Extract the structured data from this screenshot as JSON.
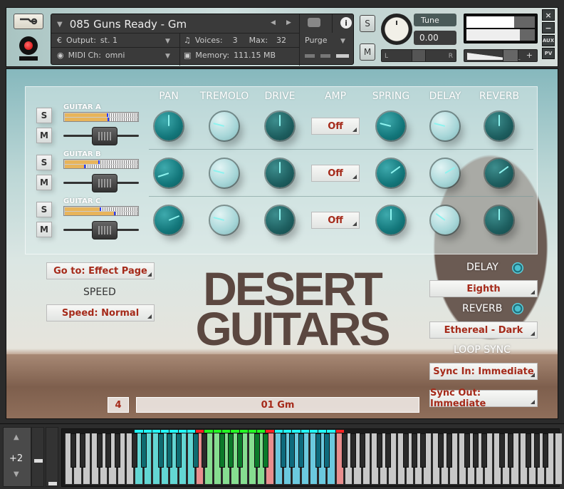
{
  "header": {
    "instrument_name": "085 Guns Ready - Gm",
    "output_label": "Output:",
    "output_value": "st. 1",
    "voices_label": "Voices:",
    "voices_value": "3",
    "max_label": "Max:",
    "max_value": "32",
    "midi_label": "MIDI Ch:",
    "midi_value": "omni",
    "memory_label": "Memory:",
    "memory_value": "111.15 MB",
    "purge_label": "Purge",
    "solo": "S",
    "mute": "M",
    "tune_label": "Tune",
    "tune_value": "0.00",
    "pan_left": "L",
    "pan_right": "R",
    "vol_minus": "−",
    "vol_plus": "+",
    "close": "×",
    "minimize": "−",
    "aux": "AUX",
    "pv": "PV",
    "meter_levels": [
      0.7,
      0.78
    ]
  },
  "fx": {
    "columns": [
      "PAN",
      "TREMOLO",
      "DRIVE",
      "AMP",
      "SPRING",
      "DELAY",
      "REVERB"
    ],
    "tracks": [
      {
        "name": "GUITAR A",
        "solo": "S",
        "mute": "M",
        "meter": [
          0.6,
          0.61
        ],
        "fader": 0.55,
        "amp": "Off",
        "knobs": {
          "pan": 0.5,
          "tremolo": 0.22,
          "drive": 0.5,
          "spring": 0.22,
          "delay": 0.22,
          "reverb": 0.5
        }
      },
      {
        "name": "GUITAR B",
        "solo": "S",
        "mute": "M",
        "meter": [
          0.48,
          0.28
        ],
        "fader": 0.55,
        "amp": "Off",
        "knobs": {
          "pan": 0.1,
          "tremolo": 0.22,
          "drive": 0.5,
          "spring": 0.7,
          "delay": 0.72,
          "reverb": 0.7
        }
      },
      {
        "name": "GUITAR C",
        "solo": "S",
        "mute": "M",
        "meter": [
          0.5,
          0.7
        ],
        "fader": 0.55,
        "amp": "Off",
        "knobs": {
          "pan": 0.75,
          "tremolo": 0.22,
          "drive": 0.5,
          "spring": 0.5,
          "delay": 0.3,
          "reverb": 0.5
        }
      }
    ]
  },
  "left": {
    "goto": "Go to: Effect Page",
    "speed_label": "SPEED",
    "speed": "Speed: Normal"
  },
  "logo": {
    "line1": "DESERT",
    "line2": "GUITARS"
  },
  "right": {
    "delay_label": "DELAY",
    "delay_value": "Eighth",
    "reverb_label": "REVERB",
    "reverb_value": "Ethereal - Dark",
    "loop_sync_label": "LOOP SYNC",
    "sync_in": "Sync In: Immediate",
    "sync_out": "Sync Out: Immediate"
  },
  "bottom": {
    "pattern_number": "4",
    "pattern_name": "01 Gm"
  },
  "keyboard": {
    "octave": "+2"
  }
}
